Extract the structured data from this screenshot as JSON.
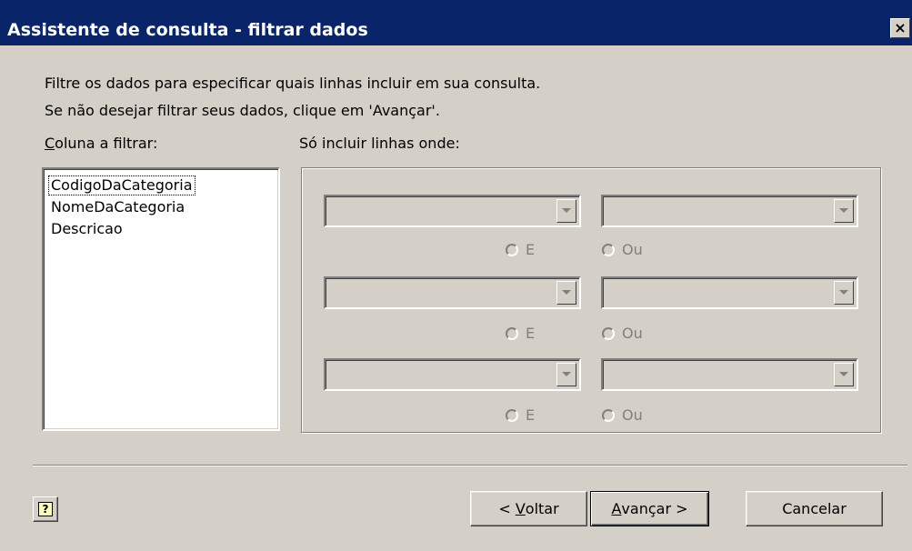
{
  "window": {
    "title": "Assistente de consulta - filtrar dados",
    "close_label": "×"
  },
  "intro": {
    "line1": "Filtre os dados para especificar quais linhas incluir em sua consulta.",
    "line2": "Se não desejar filtrar seus dados, clique em 'Avançar'."
  },
  "column_label": {
    "mnemonic": "C",
    "rest": "oluna a filtrar:"
  },
  "rows_label": "Só incluir linhas onde:",
  "columns": [
    "CodigoDaCategoria",
    "NomeDaCategoria",
    "Descricao"
  ],
  "filters": {
    "and_label": "E",
    "or_label": "Ou"
  },
  "buttons": {
    "help": "?",
    "back_prefix": "< ",
    "back_mnemonic": "V",
    "back_rest": "oltar",
    "next_mnemonic": "A",
    "next_rest": "vançar >",
    "cancel": "Cancelar"
  },
  "icons": {
    "close": "close-icon",
    "help": "help-icon",
    "dropdown": "chevron-down-icon",
    "radio": "radio-icon"
  }
}
